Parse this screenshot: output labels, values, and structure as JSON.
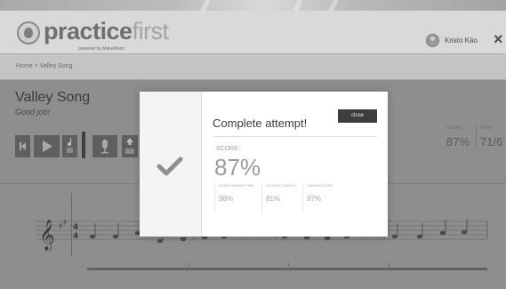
{
  "header": {
    "logo_main": "practice",
    "logo_accent": "first",
    "logo_tagline": "powered by MakeMusic",
    "user_name": "Kristo Käo",
    "close_label": "×"
  },
  "breadcrumb": "Home > Valley Song",
  "song": {
    "title": "Valley Song",
    "subtitle": "Good job!"
  },
  "scores": {
    "score_label": "SCORE",
    "score_value": "87%",
    "bpm_label": "BPM",
    "bpm_value": "71/6"
  },
  "modal": {
    "title": "Complete attempt!",
    "close_label": "close",
    "score_label": "SCORE:",
    "score_value": "87%",
    "breakdown": [
      {
        "label": "DURATION/RHYTHM",
        "value": "98%"
      },
      {
        "label": "NOTE/ACCURACY",
        "value": "81%"
      },
      {
        "label": "TIMING/SCORE",
        "value": "97%"
      }
    ]
  },
  "icons": {
    "skip_back": "skip-back-icon",
    "play": "play-icon",
    "music_note": "music-note-icon",
    "microphone": "microphone-icon",
    "upload": "upload-icon",
    "check": "checkmark-icon",
    "user": "user-icon",
    "close": "close-icon"
  },
  "colors": {
    "modal_close_bg": "#3d3d3d",
    "control_bg": "#5f5f5f",
    "check_color": "#8f8f8f"
  }
}
